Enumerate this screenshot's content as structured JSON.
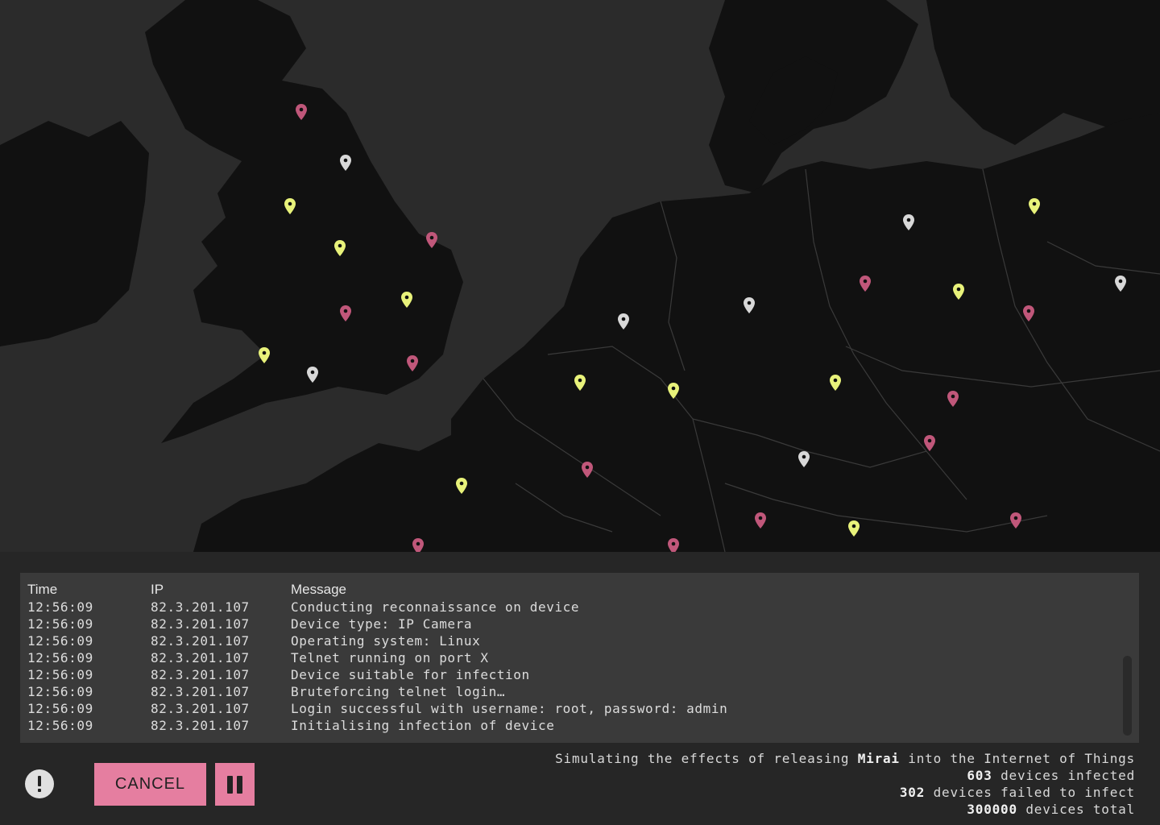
{
  "colors": {
    "infected": "#c0577a",
    "failed": "#e8f27a",
    "scanning": "#d8d8d8",
    "accent": "#e57ea0"
  },
  "map": {
    "pins": [
      {
        "status": "infected"
      },
      {
        "status": "scanning"
      },
      {
        "status": "failed"
      },
      {
        "status": "failed"
      },
      {
        "status": "infected"
      },
      {
        "status": "failed"
      },
      {
        "status": "infected"
      },
      {
        "status": "failed"
      },
      {
        "status": "scanning"
      },
      {
        "status": "infected"
      },
      {
        "status": "scanning"
      },
      {
        "status": "scanning"
      },
      {
        "status": "failed"
      },
      {
        "status": "failed"
      },
      {
        "status": "infected"
      },
      {
        "status": "failed"
      },
      {
        "status": "scanning"
      },
      {
        "status": "infected"
      },
      {
        "status": "failed"
      },
      {
        "status": "failed"
      },
      {
        "status": "infected"
      },
      {
        "status": "scanning"
      },
      {
        "status": "infected"
      },
      {
        "status": "infected"
      },
      {
        "status": "scanning"
      },
      {
        "status": "infected"
      },
      {
        "status": "infected"
      },
      {
        "status": "failed"
      },
      {
        "status": "failed"
      },
      {
        "status": "infected"
      },
      {
        "status": "infected"
      }
    ]
  },
  "log": {
    "headers": {
      "time": "Time",
      "ip": "IP",
      "message": "Message"
    },
    "rows": [
      {
        "time": "12:56:09",
        "ip": "82.3.201.107",
        "message": "Conducting reconnaissance on device"
      },
      {
        "time": "12:56:09",
        "ip": "82.3.201.107",
        "message": "Device type: IP Camera"
      },
      {
        "time": "12:56:09",
        "ip": "82.3.201.107",
        "message": "Operating system: Linux"
      },
      {
        "time": "12:56:09",
        "ip": "82.3.201.107",
        "message": "Telnet running on port X"
      },
      {
        "time": "12:56:09",
        "ip": "82.3.201.107",
        "message": "Device suitable for infection"
      },
      {
        "time": "12:56:09",
        "ip": "82.3.201.107",
        "message": "Bruteforcing telnet login…"
      },
      {
        "time": "12:56:09",
        "ip": "82.3.201.107",
        "message": "Login successful with username: root, password: admin"
      },
      {
        "time": "12:56:09",
        "ip": "82.3.201.107",
        "message": "Initialising infection of device"
      }
    ]
  },
  "controls": {
    "warning_icon": "exclamation-circle-icon",
    "cancel_label": "CANCEL",
    "pause_icon": "pause-icon"
  },
  "stats": {
    "intro_prefix": "Simulating the effects of releasing ",
    "malware_name": "Mirai",
    "intro_suffix": " into the Internet of Things",
    "infected_count": "603",
    "infected_label": " devices infected",
    "failed_count": "302",
    "failed_label": " devices failed to infect",
    "total_count": "300000",
    "total_label": " devices total"
  }
}
